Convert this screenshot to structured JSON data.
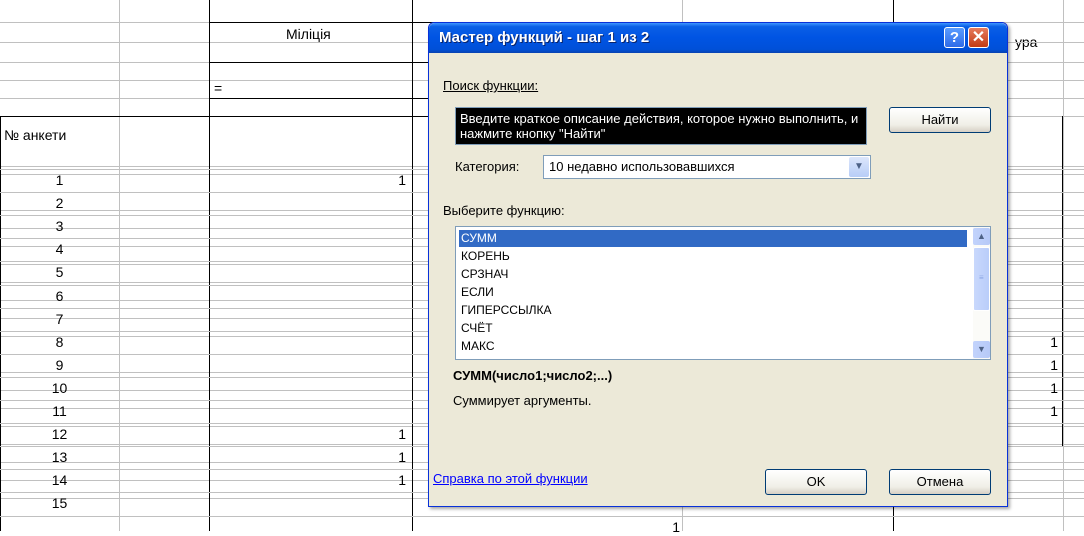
{
  "sheet": {
    "header_militsiya": "Міліція",
    "header_right_partial": "ура",
    "formula_cell": "=",
    "anketa_header": "№ анкети",
    "row_numbers": [
      "1",
      "2",
      "3",
      "4",
      "5",
      "6",
      "7",
      "8",
      "9",
      "10",
      "11",
      "12",
      "13",
      "14",
      "15"
    ],
    "col_b_values": [
      "1",
      "",
      "",
      "",
      "",
      "",
      "",
      "",
      "",
      "",
      "",
      "1",
      "1",
      "1",
      ""
    ],
    "col_e_values": [
      "",
      "",
      "",
      "",
      "",
      "",
      "",
      "1",
      "1",
      "1",
      "1",
      "",
      "",
      "",
      ""
    ],
    "col_c_last": "1"
  },
  "dialog": {
    "title": "Мастер функций - шаг 1 из 2",
    "help_button": "?",
    "close_button": "✕",
    "search_label": "Поиск функции:",
    "search_text": "Введите краткое описание действия, которое нужно выполнить, и нажмите кнопку \"Найти\"",
    "find_button": "Найти",
    "category_label": "Категория:",
    "category_value": "10 недавно использовавшихся",
    "function_list_label": "Выберите функцию:",
    "functions": [
      "СУММ",
      "КОРЕНЬ",
      "СРЗНАЧ",
      "ЕСЛИ",
      "ГИПЕРССЫЛКА",
      "СЧЁТ",
      "МАКС"
    ],
    "selected_function": "СУММ",
    "signature": "СУММ(число1;число2;...)",
    "description": "Суммирует аргументы.",
    "help_link": "Справка по этой функции",
    "ok_button": "OK",
    "cancel_button": "Отмена"
  }
}
